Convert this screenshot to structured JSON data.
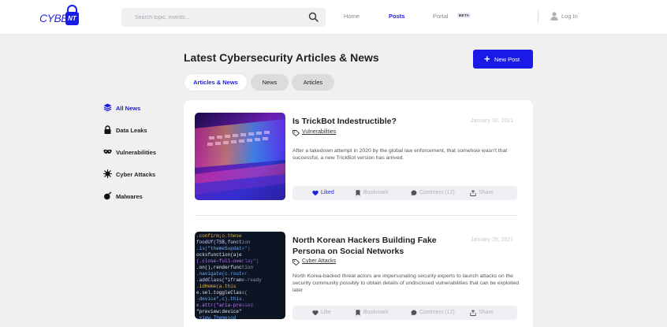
{
  "brand": {
    "logo_text": "CYBER",
    "logo_badge": "NT"
  },
  "search": {
    "placeholder": "Search topic, events..."
  },
  "nav": {
    "home": "Home",
    "posts": "Posts",
    "portal": "Portal",
    "portal_badge": "BETA",
    "login": "Log In",
    "active": "Posts"
  },
  "page": {
    "title": "Latest Cybersecurity Articles & News",
    "new_post": "New Post"
  },
  "tabs": [
    {
      "label": "Articles & News",
      "active": true
    },
    {
      "label": "News",
      "active": false
    },
    {
      "label": "Articles",
      "active": false
    }
  ],
  "sidebar": {
    "items": [
      {
        "label": "All News",
        "icon": "layers-icon",
        "active": true
      },
      {
        "label": "Data Leaks",
        "icon": "lock-icon",
        "active": false
      },
      {
        "label": "Vulnerabilities",
        "icon": "mask-icon",
        "active": false
      },
      {
        "label": "Cyber Attacks",
        "icon": "virus-icon",
        "active": false
      },
      {
        "label": "Malwares",
        "icon": "bomb-icon",
        "active": false
      }
    ]
  },
  "posts": [
    {
      "title": "Is TrickBot Indestructible?",
      "date": "January 30, 2021",
      "tag": "Vulnerabilities",
      "description": "After a takedown attempt in 2020 by the global law enforcement, that somehow wasn't that successful, a new TrickBot version has arrived.",
      "image": "laptop-keyboard-neon-image",
      "actions": {
        "like": "Liked",
        "liked": true,
        "bookmark": "Bookmark",
        "comment": "Comment (12)",
        "share": "Share"
      }
    },
    {
      "title": "North Korean Hackers Building Fake Persona on Social Networks",
      "date": "January 29, 2021",
      "tag": "Cyber Attacks",
      "description": "North Korea-backed threat actors are impersonating security experts to launch attacks on the security community possibly to obtain details of undisclosed vulnerabilities that can be exploited later",
      "image": "source-code-screen-image",
      "actions": {
        "like": "Like",
        "liked": false,
        "bookmark": "Bookmark",
        "comment": "Comment (12)",
        "share": "Share"
      }
    }
  ],
  "colors": {
    "accent": "#1a1ae6",
    "background": "#f0f0f0",
    "card": "#ffffff"
  }
}
